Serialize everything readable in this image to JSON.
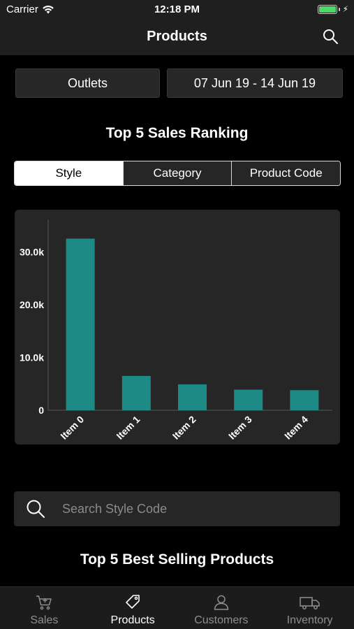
{
  "status": {
    "carrier": "Carrier",
    "time": "12:18 PM"
  },
  "nav": {
    "title": "Products"
  },
  "filters": {
    "outlets": "Outlets",
    "date_range": "07 Jun 19 - 14 Jun 19"
  },
  "ranking": {
    "title": "Top 5 Sales Ranking",
    "segments": [
      {
        "label": "Style",
        "active": true
      },
      {
        "label": "Category",
        "active": false
      },
      {
        "label": "Product Code",
        "active": false
      }
    ]
  },
  "chart_data": {
    "type": "bar",
    "categories": [
      "Item 0",
      "Item 1",
      "Item 2",
      "Item 3",
      "Item 4"
    ],
    "values": [
      32500,
      6500,
      4900,
      3900,
      3800
    ],
    "yticks": [
      0,
      10000,
      20000,
      30000
    ],
    "ytick_labels": [
      "0",
      "10.0k",
      "20.0k",
      "30.0k"
    ],
    "ylim": [
      0,
      36000
    ],
    "bar_color": "#1e8a86",
    "title": "",
    "xlabel": "",
    "ylabel": ""
  },
  "search": {
    "placeholder": "Search Style Code"
  },
  "best": {
    "title": "Top 5 Best Selling Products"
  },
  "tabs": [
    {
      "label": "Sales",
      "icon": "cart-icon",
      "active": false
    },
    {
      "label": "Products",
      "icon": "tag-icon",
      "active": true
    },
    {
      "label": "Customers",
      "icon": "person-icon",
      "active": false
    },
    {
      "label": "Inventory",
      "icon": "truck-icon",
      "active": false
    }
  ],
  "colors": {
    "battery": "#4cd964",
    "active_segment": "#ffffff"
  }
}
